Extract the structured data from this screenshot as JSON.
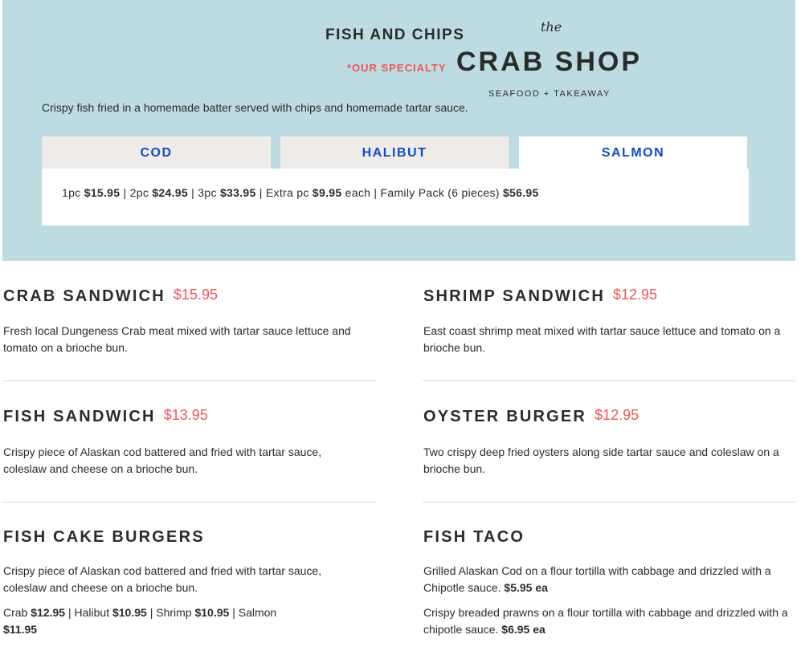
{
  "hero": {
    "title": "FISH AND CHIPS",
    "specialty": "*OUR SPECIALTY",
    "logo": {
      "the": "the",
      "name": "CRAB SHOP",
      "tagline": "SEAFOOD + TAKEAWAY"
    },
    "description": "Crispy fish fried in a homemade batter served with chips and homemade tartar sauce.",
    "tabs": [
      {
        "label": "COD"
      },
      {
        "label": "HALIBUT"
      },
      {
        "label": "SALMON"
      }
    ],
    "active_tab": "SALMON",
    "prices": {
      "p1_label": "1pc",
      "p1_price": "$15.95",
      "p2_label": "2pc",
      "p2_price": "$24.95",
      "p3_label": "3pc",
      "p3_price": "$33.95",
      "extra_label": "Extra pc",
      "extra_price": "$9.95",
      "extra_suffix": "each",
      "family_label": "Family Pack (6 pieces)",
      "family_price": "$56.95"
    }
  },
  "items": {
    "crab_sandwich": {
      "name": "CRAB SANDWICH",
      "price": "$15.95",
      "desc": "Fresh local Dungeness Crab meat mixed with tartar sauce lettuce and tomato on a brioche bun."
    },
    "shrimp_sandwich": {
      "name": "SHRIMP SANDWICH",
      "price": "$12.95",
      "desc": "East coast shrimp meat mixed with tartar sauce lettuce and tomato on a brioche bun."
    },
    "fish_sandwich": {
      "name": "FISH SANDWICH",
      "price": "$13.95",
      "desc": "Crispy piece of Alaskan cod battered and fried with tartar sauce, coleslaw and cheese on a brioche bun."
    },
    "oyster_burger": {
      "name": "OYSTER BURGER",
      "price": "$12.95",
      "desc": "Two crispy deep fried oysters along side tartar sauce and coleslaw on a brioche bun."
    },
    "fish_cake_burgers": {
      "name": "FISH CAKE BURGERS",
      "desc": "Crispy piece of Alaskan cod battered and fried with tartar sauce, coleslaw and cheese on a brioche bun.",
      "options": {
        "crab_label": "Crab",
        "crab_price": "$12.95",
        "halibut_label": "Halibut",
        "halibut_price": "$10.95",
        "shrimp_label": "Shrimp",
        "shrimp_price": "$10.95",
        "salmon_label": "Salmon",
        "salmon_price": "$11.95"
      }
    },
    "fish_taco": {
      "name": "FISH TACO",
      "desc1": "Grilled Alaskan Cod on a flour tortilla with cabbage and drizzled with a Chipotle sauce.",
      "desc1_price": "$5.95 ea",
      "desc2": "Crispy breaded prawns on a flour tortilla with cabbage and drizzled with a chipotle sauce.",
      "desc2_price": "$6.95 ea"
    }
  },
  "colors": {
    "hero_bg": "#bcdce1",
    "accent_red": "#f0545a",
    "tab_blue": "#0b4fc2",
    "tab_inactive_bg": "#eeebe8",
    "divider": "#c9e0e4"
  }
}
